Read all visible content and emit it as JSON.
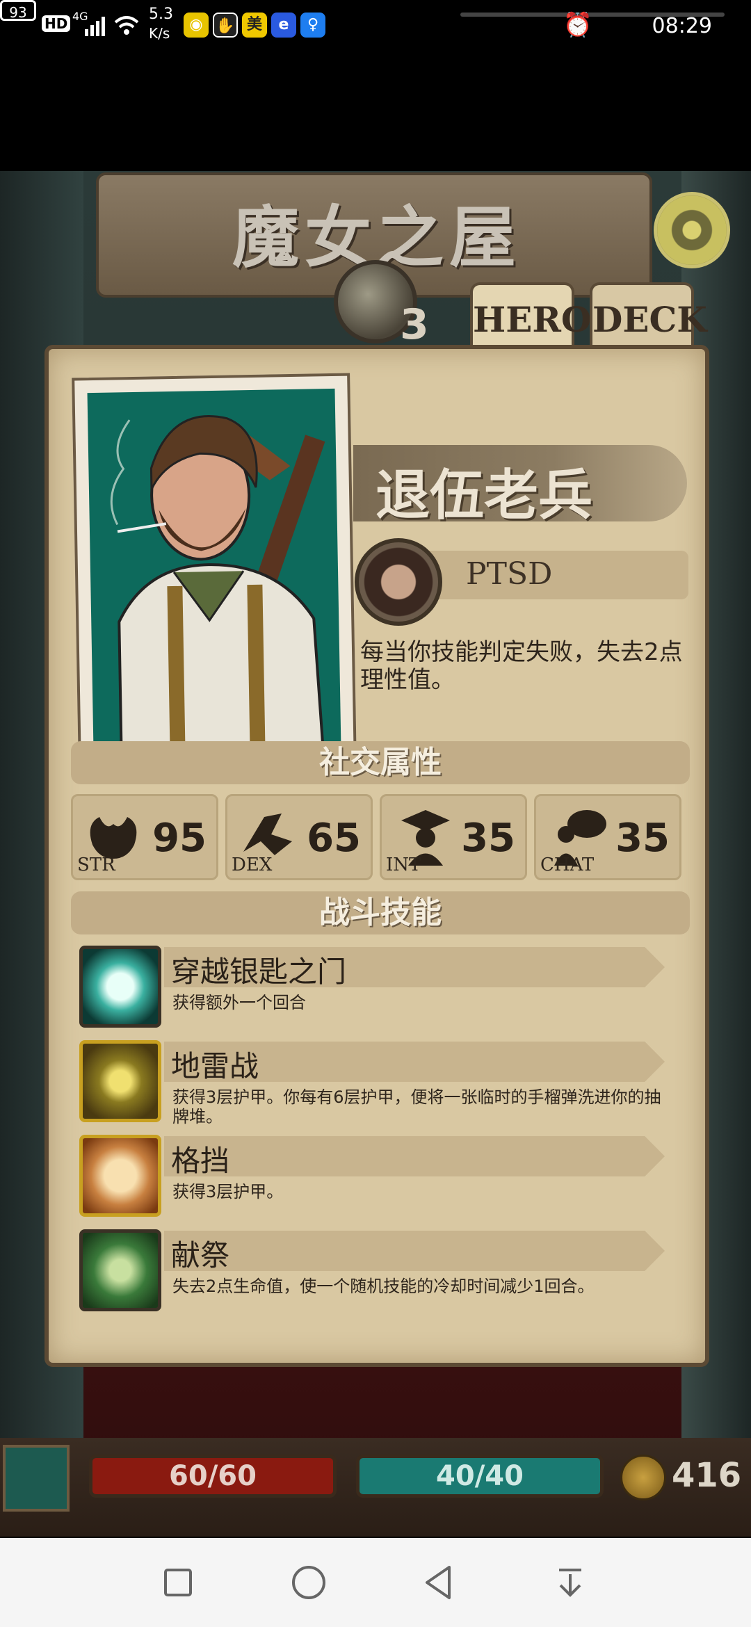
{
  "status_bar": {
    "hd": "HD",
    "network": "4G",
    "speed_value": "5.3",
    "speed_unit": "K/s",
    "battery": "93",
    "time": "08:29",
    "app_icons": [
      "weibo-icon",
      "hand-icon",
      "meituan-icon",
      "browser-icon",
      "bulb-icon"
    ]
  },
  "header": {
    "title": "魔女之屋",
    "level": "3"
  },
  "tabs": [
    {
      "label": "HERO",
      "active": true
    },
    {
      "label": "DECK",
      "active": false
    }
  ],
  "hero": {
    "name": "退伍老兵",
    "trait": {
      "name": "PTSD",
      "description": "每当你技能判定失败，失去2点理性值。"
    }
  },
  "social": {
    "title": "社交属性",
    "stats": [
      {
        "label": "STR",
        "value": "95",
        "icon": "strength-icon"
      },
      {
        "label": "DEX",
        "value": "65",
        "icon": "dexterity-icon"
      },
      {
        "label": "INT",
        "value": "35",
        "icon": "intelligence-icon"
      },
      {
        "label": "CHAT",
        "value": "35",
        "icon": "chat-icon"
      }
    ]
  },
  "combat": {
    "title": "战斗技能",
    "skills": [
      {
        "name": "穿越银匙之门",
        "description": "获得额外一个回合",
        "icon": "silver-key-gate-icon"
      },
      {
        "name": "地雷战",
        "description": "获得3层护甲。你每有6层护甲，便将一张临时的手榴弹洗进你的抽牌堆。",
        "icon": "landmine-icon"
      },
      {
        "name": "格挡",
        "description": "获得3层护甲。",
        "icon": "block-icon"
      },
      {
        "name": "献祭",
        "description": "失去2点生命值，使一个随机技能的冷却时间减少1回合。",
        "icon": "sacrifice-icon"
      }
    ]
  },
  "hud": {
    "hp": "60/60",
    "sanity": "40/40",
    "gold": "416"
  },
  "colors": {
    "parchment": "#d9c8a2",
    "hp_bar": "#8a1a10",
    "sanity_bar": "#1a7a72",
    "portrait_bg": "#0d6a5c"
  }
}
